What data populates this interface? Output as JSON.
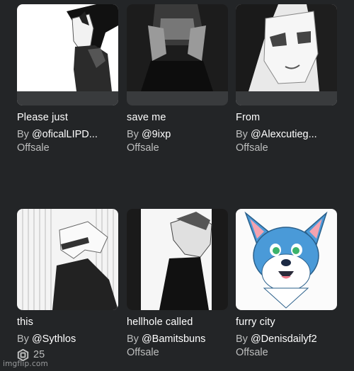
{
  "items": [
    {
      "name": "Please just",
      "by": "By",
      "creator": "@oficalLIPD...",
      "price": "Offsale"
    },
    {
      "name": "save me",
      "by": "By",
      "creator": "@9ixp",
      "price": "Offsale"
    },
    {
      "name": "From",
      "by": "By",
      "creator": "@Alexcutieg...",
      "price": "Offsale"
    },
    {
      "name": "this",
      "by": "By",
      "creator": "@Sythlos",
      "price": "25",
      "price_icon": "robux-icon"
    },
    {
      "name": "hellhole called",
      "by": "By",
      "creator": "@Bamitsbuns",
      "price": "Offsale"
    },
    {
      "name": "furry city",
      "by": "By",
      "creator": "@Denisdailyf2",
      "price": "Offsale"
    }
  ],
  "watermark": "imgflip.com",
  "colors": {
    "background": "#232527",
    "thumb_bg": "#393b3d",
    "text_primary": "#ffffff",
    "text_secondary": "#bdbebe"
  }
}
